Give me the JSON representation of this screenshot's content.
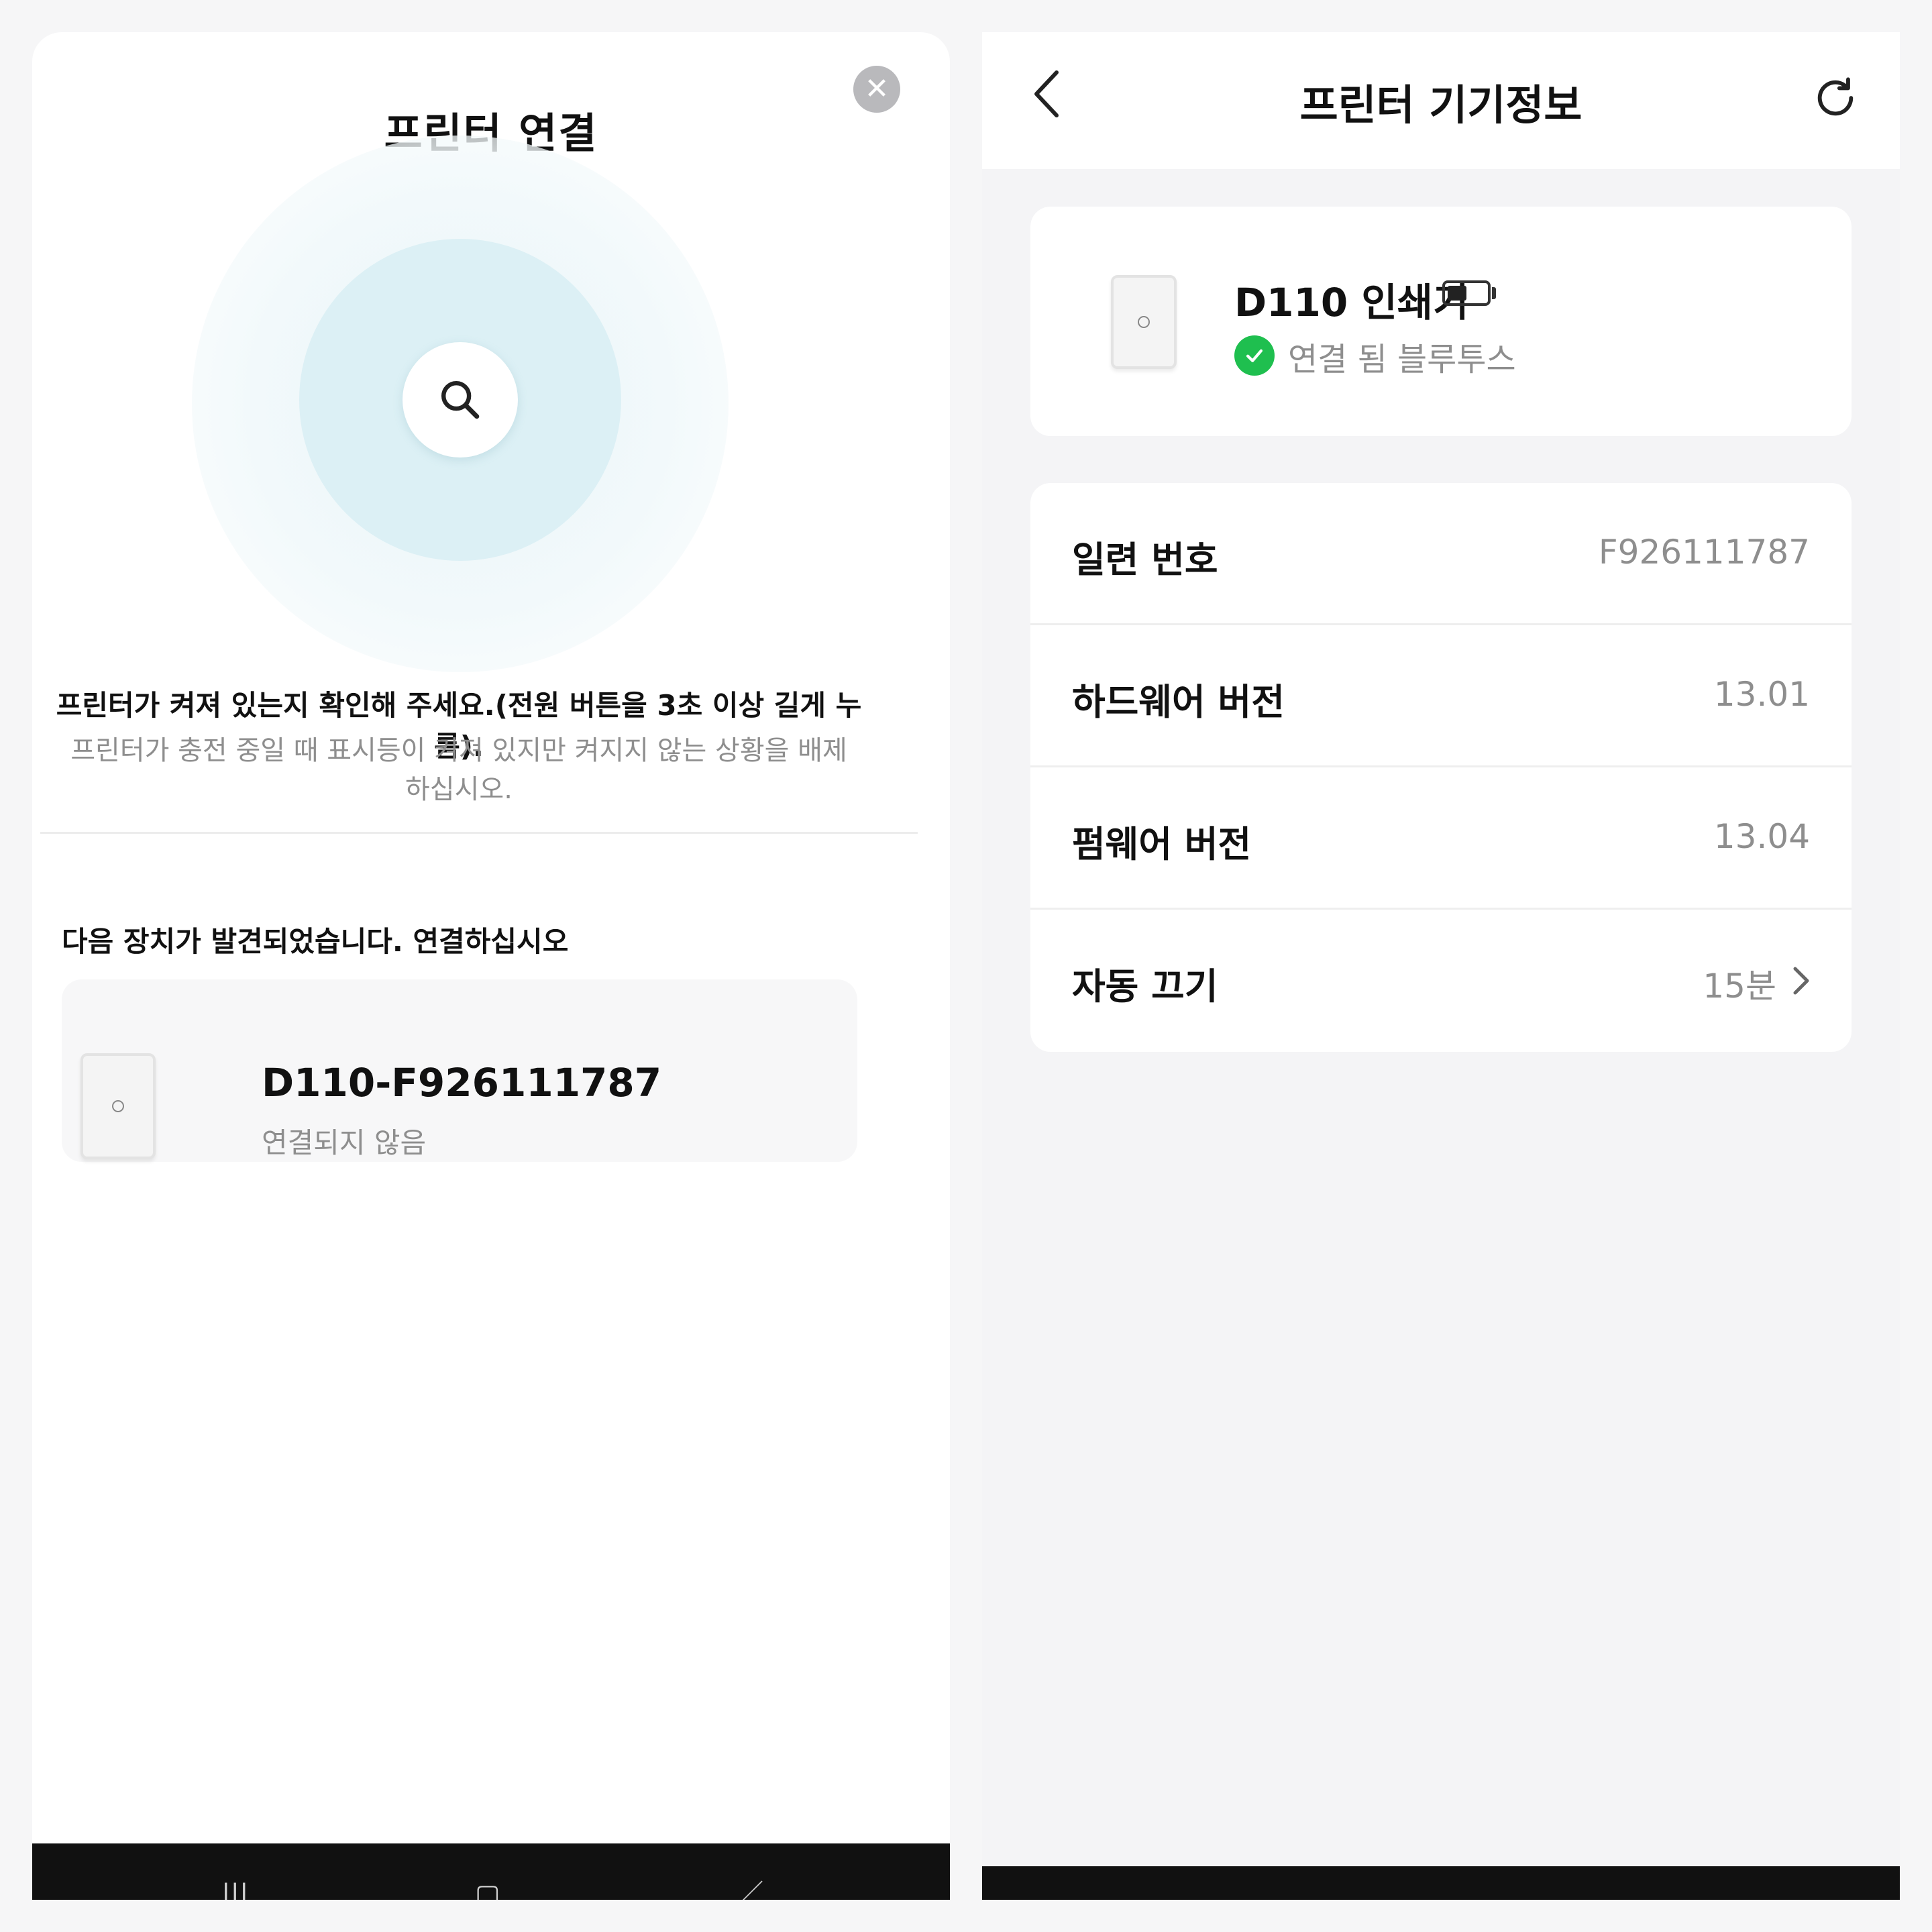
{
  "left": {
    "title": "프린터 연결",
    "close_icon": "close-icon",
    "search_icon": "search-icon",
    "hint_main": "프린터가 켜져 있는지 확인해 주세요.(전원 버튼을 3초 이상 길게 누름).",
    "hint_sub": "프린터가 충전 중일 때 표시등이 켜져 있지만 켜지지 않는 상황을 배제 하십시오.",
    "found_label": "다음 장치가 발견되었습니다. 연결하십시오",
    "device": {
      "name": "D110-F926111787",
      "status": "연결되지 않음"
    },
    "nav": {
      "recent_icon": "recent-apps-icon",
      "home_icon": "home-icon",
      "back_icon": "back-nav-icon"
    },
    "colors": {
      "accent": "#8c1e18",
      "radar": "#dcf0f5"
    }
  },
  "right": {
    "title": "프린터 기기정보",
    "back_icon": "chevron-left-icon",
    "refresh_icon": "refresh-icon",
    "printer": {
      "name": "D110 인쇄기",
      "battery_icon": "battery-icon",
      "battery_level": 0.5,
      "status": "연결 됨 블루투스",
      "status_icon": "check-circle-icon",
      "status_color": "#1fbf4f"
    },
    "details": [
      {
        "label": "일련 번호",
        "value": "F926111787"
      },
      {
        "label": "하드웨어 버전",
        "value": "13.01"
      },
      {
        "label": "펌웨어 버전",
        "value": "13.04"
      },
      {
        "label": "자동 끄기",
        "value": "15분"
      }
    ]
  }
}
